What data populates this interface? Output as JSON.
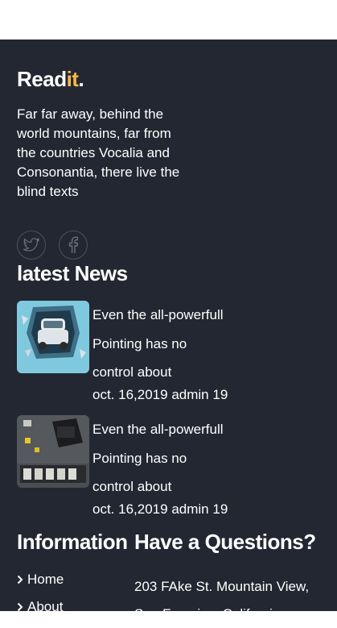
{
  "brand": {
    "name_main": "Read",
    "name_accent": "it",
    "name_dot": ".",
    "accent_color": "#f9b944"
  },
  "about_text": "Far far away, behind the world mountains, far from the countries Vocalia and Consonantia, there live the blind texts",
  "social": [
    {
      "icon": "twitter-icon"
    },
    {
      "icon": "facebook-icon"
    }
  ],
  "latest_news": {
    "heading": "latest News",
    "posts": [
      {
        "title_lines": [
          "Even the all-powerfull",
          "Pointing has no",
          "control about"
        ],
        "date": "oct. 16,2019",
        "author": "admin",
        "comments": "19"
      },
      {
        "title_lines": [
          "Even the all-powerfull",
          "Pointing has no",
          "control about"
        ],
        "date": "oct. 16,2019",
        "author": "admin",
        "comments": "19"
      }
    ]
  },
  "information": {
    "heading": "Information",
    "links": [
      "Home",
      "About"
    ]
  },
  "questions": {
    "heading": "Have a Questions?",
    "address_lines": [
      "203 FAke St. Mountain View,",
      "San Fransico, California"
    ]
  },
  "colors": {
    "footer_bg": "#232731",
    "text": "#ffffff",
    "icon_border": "#4e525b"
  }
}
